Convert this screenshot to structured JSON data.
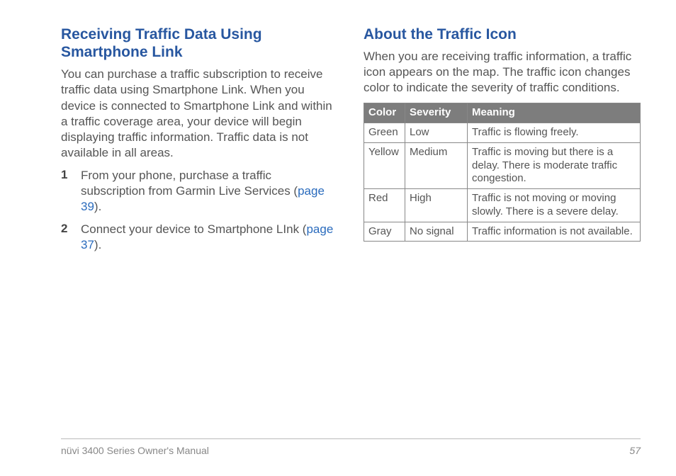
{
  "left": {
    "heading": "Receiving Traffic Data Using Smartphone Link",
    "paragraph": "You can purchase a traffic subscription to receive traffic data using Smartphone Link. When you device is connected to Smartphone Link and within a traffic coverage area, your device will begin displaying traffic information. Traffic data is not available in all areas.",
    "steps": [
      {
        "num": "1",
        "text_pre": "From your phone, purchase a traffic subscription from Garmin Live Services (",
        "ref": "page 39",
        "text_post": ")."
      },
      {
        "num": "2",
        "text_pre": "Connect your device to Smartphone LInk (",
        "ref": "page 37",
        "text_post": ")."
      }
    ]
  },
  "right": {
    "heading": "About the Traffic Icon",
    "paragraph": "When you are receiving traffic information, a traffic icon appears on the map. The traffic icon changes color to indicate the severity of traffic conditions.",
    "table": {
      "headers": [
        "Color",
        "Severity",
        "Meaning"
      ],
      "rows": [
        {
          "color": "Green",
          "severity": "Low",
          "meaning": "Traffic is flowing freely."
        },
        {
          "color": "Yellow",
          "severity": "Medium",
          "meaning": "Traffic is moving but there is a delay. There is moderate traffic congestion."
        },
        {
          "color": "Red",
          "severity": "High",
          "meaning": "Traffic is not moving or moving slowly. There is a severe delay."
        },
        {
          "color": "Gray",
          "severity": "No signal",
          "meaning": "Traffic information is not available."
        }
      ]
    }
  },
  "footer": {
    "left": "nüvi 3400 Series Owner's Manual",
    "right": "57"
  }
}
